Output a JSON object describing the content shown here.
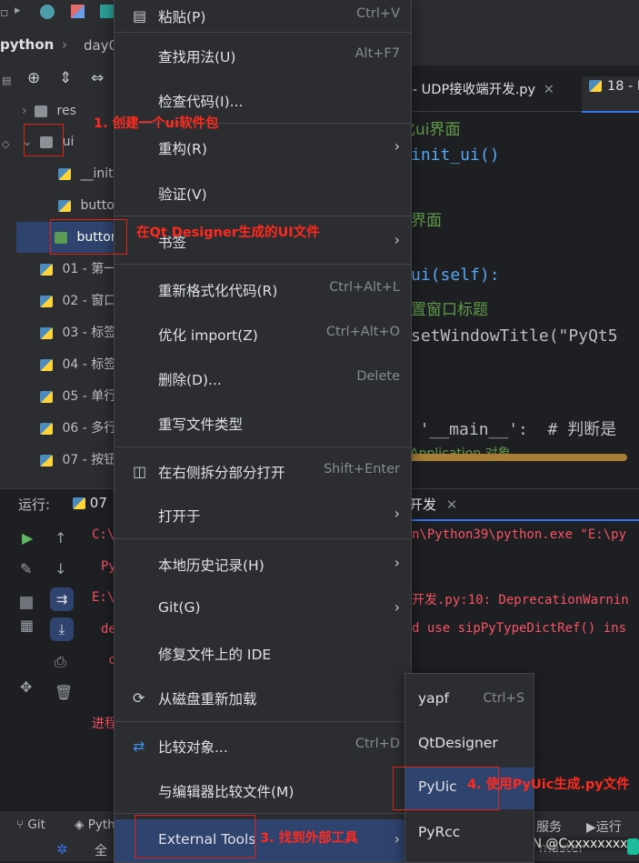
{
  "topbar": {
    "project_label": "python",
    "breadcrumb": "day0"
  },
  "tree": {
    "items": [
      {
        "label": "res",
        "kind": "folder"
      },
      {
        "label": "ui",
        "kind": "package"
      },
      {
        "label": "__init",
        "kind": "py"
      },
      {
        "label": "buttor",
        "kind": "py"
      },
      {
        "label": "buttor",
        "kind": "ui"
      },
      {
        "label": "01 - 第一",
        "kind": "py"
      },
      {
        "label": "02 - 窗口",
        "kind": "py"
      },
      {
        "label": "03 - 标签",
        "kind": "py"
      },
      {
        "label": "04 - 标签",
        "kind": "py"
      },
      {
        "label": "05 - 单行",
        "kind": "py"
      },
      {
        "label": "06 - 多行",
        "kind": "py"
      },
      {
        "label": "07 - 按钮",
        "kind": "py"
      }
    ]
  },
  "editor": {
    "tabs": [
      {
        "label": "7 - UDP接收端开发.py"
      },
      {
        "label": "18 - P"
      }
    ],
    "lines": [
      {
        "text": "化ui界面",
        "kind": "comment"
      },
      {
        "text": "init_ui()",
        "kind": "code"
      },
      {
        "text": "界面",
        "kind": "comment"
      },
      {
        "text": "ui(self):",
        "kind": "code"
      },
      {
        "text": "置窗口标题",
        "kind": "comment"
      },
      {
        "text": "setWindowTitle(\"PyQt5",
        "kind": "code"
      },
      {
        "text": "= '__main__':  # 判断是",
        "kind": "code"
      },
      {
        "text": "QApplication 对象",
        "kind": "comment"
      }
    ]
  },
  "run": {
    "label": "运行:",
    "tab": "07",
    "right_tab": "开发",
    "lines": [
      "C:\\",
      "Py",
      "E:\\",
      "de",
      "c",
      "进程"
    ],
    "right_lines": [
      "n\\Python39\\python.exe \"E:\\py",
      "开发.py:10: DeprecationWarnin",
      "d use sipPyTypeDictRef() ins"
    ]
  },
  "context_menu": {
    "items": [
      {
        "label": "粘贴(P)",
        "shortcut": "Ctrl+V",
        "icon": "paste-icon"
      },
      {
        "label": "查找用法(U)",
        "shortcut": "Alt+F7"
      },
      {
        "label": "检查代码(I)...",
        "shortcut": ""
      },
      {
        "label": "重构(R)",
        "submenu": true
      },
      {
        "label": "验证(V)",
        "shortcut": ""
      },
      {
        "label": "书签",
        "submenu": true
      },
      {
        "label": "重新格式化代码(R)",
        "shortcut": "Ctrl+Alt+L"
      },
      {
        "label": "优化 import(Z)",
        "shortcut": "Ctrl+Alt+O"
      },
      {
        "label": "删除(D)...",
        "shortcut": "Delete"
      },
      {
        "label": "重写文件类型",
        "shortcut": ""
      },
      {
        "label": "在右侧拆分部分打开",
        "shortcut": "Shift+Enter",
        "icon": "split-icon"
      },
      {
        "label": "打开于",
        "submenu": true
      },
      {
        "label": "本地历史记录(H)",
        "submenu": true
      },
      {
        "label": "Git(G)",
        "submenu": true
      },
      {
        "label": "修复文件上的 IDE",
        "shortcut": ""
      },
      {
        "label": "从磁盘重新加载",
        "shortcut": "",
        "icon": "reload-icon"
      },
      {
        "label": "比较对象...",
        "shortcut": "Ctrl+D",
        "icon": "compare-icon"
      },
      {
        "label": "与编辑器比较文件(M)",
        "shortcut": ""
      },
      {
        "label": "External Tools",
        "submenu": true
      }
    ]
  },
  "external_tools": {
    "items": [
      {
        "label": "yapf",
        "shortcut": "Ctrl+S"
      },
      {
        "label": "QtDesigner",
        "shortcut": ""
      },
      {
        "label": "PyUic",
        "shortcut": ""
      },
      {
        "label": "PyRcc",
        "shortcut": ""
      }
    ]
  },
  "annotations": {
    "step1": "1. 创建一个ui软件包",
    "qt_file": "在Qt Designer生成的UI文件",
    "step3": "3. 找到外部工具",
    "step4": "4. 使用PyUic生成.py文件"
  },
  "statusbar": {
    "git": "Git",
    "python": "Pyth",
    "services": "服务",
    "run": "运行",
    "branch": "master",
    "watermark": "CSDN @Cxxxxxxxx.",
    "all": "全"
  },
  "colors": {
    "accent": "#3574f0",
    "annotation": "#e0241b",
    "comment": "#5f9b48",
    "keyword": "#cf8e6d",
    "string": "#6aab73"
  }
}
